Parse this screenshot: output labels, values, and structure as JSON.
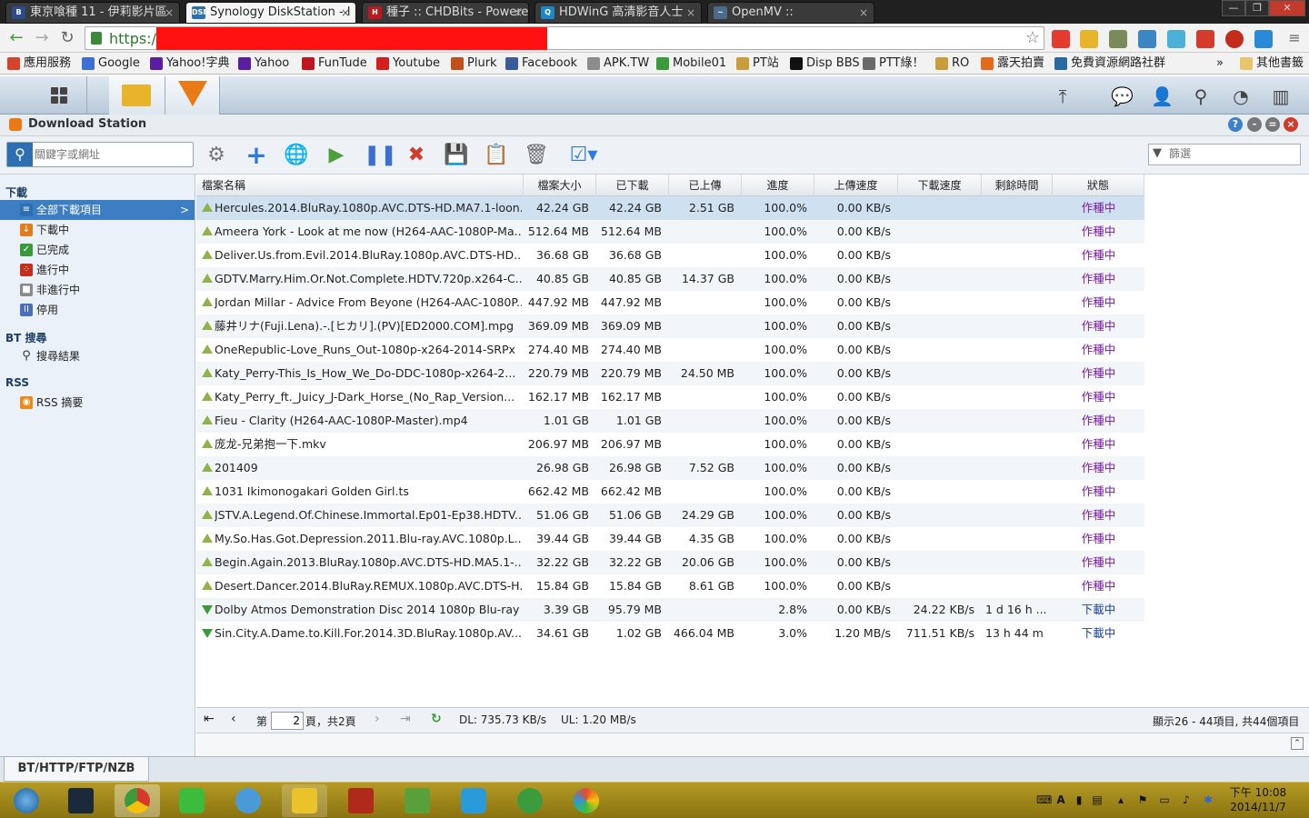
{
  "browser": {
    "tabs": [
      {
        "title": "東京喰種 11 - 伊莉影片區",
        "icon": "B",
        "color": "#2b4c8c"
      },
      {
        "title": "Synology DiskStation - l",
        "icon": "DSM",
        "color": "#2d6fb0"
      },
      {
        "title": "種子 :: CHDBits - Powere",
        "icon": "H",
        "color": "#c0161d"
      },
      {
        "title": "HDWinG 高清影音人士",
        "icon": "Q",
        "color": "#1a87c9"
      },
      {
        "title": "OpenMV ::",
        "icon": "~",
        "color": "#4a6b8a"
      }
    ],
    "close_glyph": "×",
    "url_scheme": "https://",
    "bookmarks": [
      {
        "label": "應用服務",
        "color": "#d4432b"
      },
      {
        "label": "Google",
        "color": "#3b6fd6"
      },
      {
        "label": "Yahoo!字典",
        "color": "#5a1fa0"
      },
      {
        "label": "Yahoo",
        "color": "#5a1fa0"
      },
      {
        "label": "FunTude",
        "color": "#c0161d"
      },
      {
        "label": "Youtube",
        "color": "#d4201c"
      },
      {
        "label": "Plurk",
        "color": "#c2501c"
      },
      {
        "label": "Facebook",
        "color": "#3a5a98"
      },
      {
        "label": "APK.TW",
        "color": "#8c8c8c"
      },
      {
        "label": "Mobile01",
        "color": "#3a9a3a"
      },
      {
        "label": "PT站",
        "color": "#c89d3b"
      },
      {
        "label": "Disp BBS",
        "color": "#111111"
      },
      {
        "label": "PTT綠！",
        "color": "#6a6a6a"
      },
      {
        "label": "RO",
        "color": "#c89d3b"
      },
      {
        "label": "露天拍賣",
        "color": "#e56b1a"
      },
      {
        "label": "免費資源網路社群",
        "color": "#2a6aa0"
      }
    ],
    "more": "»",
    "other_bookmarks": "其他書籤"
  },
  "app": {
    "title": "Download Station",
    "search_placeholder": "關鍵字或網址",
    "filter_placeholder": "篩選",
    "sidebar": {
      "download_group": "下載",
      "items": [
        {
          "label": "全部下載項目",
          "color": "#2d6fb0",
          "glyph": "≡"
        },
        {
          "label": "下載中",
          "color": "#e57b1a",
          "glyph": "↓"
        },
        {
          "label": "已完成",
          "color": "#3a9a3a",
          "glyph": "✓"
        },
        {
          "label": "進行中",
          "color": "#c0301c",
          "glyph": "⁘"
        },
        {
          "label": "非進行中",
          "color": "#8a8a8a",
          "glyph": "■"
        },
        {
          "label": "停用",
          "color": "#4a6fc0",
          "glyph": "II"
        }
      ],
      "bt_group": "BT 搜尋",
      "bt_item": "搜尋結果",
      "rss_group": "RSS",
      "rss_item": "RSS 摘要",
      "selected_arrow": ">"
    },
    "columns": [
      "檔案名稱",
      "檔案大小",
      "已下載",
      "已上傳",
      "進度",
      "上傳速度",
      "下載速度",
      "剩餘時間",
      "狀態"
    ],
    "rows": [
      {
        "name": "Hercules.2014.BluRay.1080p.AVC.DTS-HD.MA7.1-loon...",
        "size": "42.24 GB",
        "downloaded": "42.24 GB",
        "uploaded": "2.51 GB",
        "progress": "100.0%",
        "up_speed": "0.00 KB/s",
        "down_speed": "",
        "remaining": "",
        "status": "作種中",
        "kind": "seed"
      },
      {
        "name": "Ameera York - Look at me now (H264-AAC-1080P-Ma...",
        "size": "512.64 MB",
        "downloaded": "512.64 MB",
        "uploaded": "",
        "progress": "100.0%",
        "up_speed": "0.00 KB/s",
        "down_speed": "",
        "remaining": "",
        "status": "作種中",
        "kind": "seed"
      },
      {
        "name": "Deliver.Us.from.Evil.2014.BluRay.1080p.AVC.DTS-HD....",
        "size": "36.68 GB",
        "downloaded": "36.68 GB",
        "uploaded": "",
        "progress": "100.0%",
        "up_speed": "0.00 KB/s",
        "down_speed": "",
        "remaining": "",
        "status": "作種中",
        "kind": "seed"
      },
      {
        "name": "GDTV.Marry.Him.Or.Not.Complete.HDTV.720p.x264-C...",
        "size": "40.85 GB",
        "downloaded": "40.85 GB",
        "uploaded": "14.37 GB",
        "progress": "100.0%",
        "up_speed": "0.00 KB/s",
        "down_speed": "",
        "remaining": "",
        "status": "作種中",
        "kind": "seed"
      },
      {
        "name": "Jordan Millar - Advice From Beyone (H264-AAC-1080P...",
        "size": "447.92 MB",
        "downloaded": "447.92 MB",
        "uploaded": "",
        "progress": "100.0%",
        "up_speed": "0.00 KB/s",
        "down_speed": "",
        "remaining": "",
        "status": "作種中",
        "kind": "seed"
      },
      {
        "name": "藤井リナ(Fuji.Lena).-.[ヒカリ].(PV)[ED2000.COM].mpg",
        "size": "369.09 MB",
        "downloaded": "369.09 MB",
        "uploaded": "",
        "progress": "100.0%",
        "up_speed": "0.00 KB/s",
        "down_speed": "",
        "remaining": "",
        "status": "作種中",
        "kind": "seed"
      },
      {
        "name": "OneRepublic-Love_Runs_Out-1080p-x264-2014-SRPx",
        "size": "274.40 MB",
        "downloaded": "274.40 MB",
        "uploaded": "",
        "progress": "100.0%",
        "up_speed": "0.00 KB/s",
        "down_speed": "",
        "remaining": "",
        "status": "作種中",
        "kind": "seed"
      },
      {
        "name": "Katy_Perry-This_Is_How_We_Do-DDC-1080p-x264-2...",
        "size": "220.79 MB",
        "downloaded": "220.79 MB",
        "uploaded": "24.50 MB",
        "progress": "100.0%",
        "up_speed": "0.00 KB/s",
        "down_speed": "",
        "remaining": "",
        "status": "作種中",
        "kind": "seed"
      },
      {
        "name": "Katy_Perry_ft._Juicy_J-Dark_Horse_(No_Rap_Version...",
        "size": "162.17 MB",
        "downloaded": "162.17 MB",
        "uploaded": "",
        "progress": "100.0%",
        "up_speed": "0.00 KB/s",
        "down_speed": "",
        "remaining": "",
        "status": "作種中",
        "kind": "seed"
      },
      {
        "name": "Fieu - Clarity (H264-AAC-1080P-Master).mp4",
        "size": "1.01 GB",
        "downloaded": "1.01 GB",
        "uploaded": "",
        "progress": "100.0%",
        "up_speed": "0.00 KB/s",
        "down_speed": "",
        "remaining": "",
        "status": "作種中",
        "kind": "seed"
      },
      {
        "name": "庞龙-兄弟抱一下.mkv",
        "size": "206.97 MB",
        "downloaded": "206.97 MB",
        "uploaded": "",
        "progress": "100.0%",
        "up_speed": "0.00 KB/s",
        "down_speed": "",
        "remaining": "",
        "status": "作種中",
        "kind": "seed"
      },
      {
        "name": "201409",
        "size": "26.98 GB",
        "downloaded": "26.98 GB",
        "uploaded": "7.52 GB",
        "progress": "100.0%",
        "up_speed": "0.00 KB/s",
        "down_speed": "",
        "remaining": "",
        "status": "作種中",
        "kind": "seed"
      },
      {
        "name": "1031 Ikimonogakari Golden Girl.ts",
        "size": "662.42 MB",
        "downloaded": "662.42 MB",
        "uploaded": "",
        "progress": "100.0%",
        "up_speed": "0.00 KB/s",
        "down_speed": "",
        "remaining": "",
        "status": "作種中",
        "kind": "seed"
      },
      {
        "name": "JSTV.A.Legend.Of.Chinese.Immortal.Ep01-Ep38.HDTV...",
        "size": "51.06 GB",
        "downloaded": "51.06 GB",
        "uploaded": "24.29 GB",
        "progress": "100.0%",
        "up_speed": "0.00 KB/s",
        "down_speed": "",
        "remaining": "",
        "status": "作種中",
        "kind": "seed"
      },
      {
        "name": "My.So.Has.Got.Depression.2011.Blu-ray.AVC.1080p.L...",
        "size": "39.44 GB",
        "downloaded": "39.44 GB",
        "uploaded": "4.35 GB",
        "progress": "100.0%",
        "up_speed": "0.00 KB/s",
        "down_speed": "",
        "remaining": "",
        "status": "作種中",
        "kind": "seed"
      },
      {
        "name": "Begin.Again.2013.BluRay.1080p.AVC.DTS-HD.MA5.1-...",
        "size": "32.22 GB",
        "downloaded": "32.22 GB",
        "uploaded": "20.06 GB",
        "progress": "100.0%",
        "up_speed": "0.00 KB/s",
        "down_speed": "",
        "remaining": "",
        "status": "作種中",
        "kind": "seed"
      },
      {
        "name": "Desert.Dancer.2014.BluRay.REMUX.1080p.AVC.DTS-H...",
        "size": "15.84 GB",
        "downloaded": "15.84 GB",
        "uploaded": "8.61 GB",
        "progress": "100.0%",
        "up_speed": "0.00 KB/s",
        "down_speed": "",
        "remaining": "",
        "status": "作種中",
        "kind": "seed"
      },
      {
        "name": "Dolby Atmos Demonstration Disc 2014 1080p Blu-ray ...",
        "size": "3.39 GB",
        "downloaded": "95.79 MB",
        "uploaded": "",
        "progress": "2.8%",
        "up_speed": "0.00 KB/s",
        "down_speed": "24.22 KB/s",
        "remaining": "1 d 16 h ...",
        "status": "下載中",
        "kind": "dl"
      },
      {
        "name": "Sin.City.A.Dame.to.Kill.For.2014.3D.BluRay.1080p.AV...",
        "size": "34.61 GB",
        "downloaded": "1.02 GB",
        "uploaded": "466.04 MB",
        "progress": "3.0%",
        "up_speed": "1.20 MB/s",
        "down_speed": "711.51 KB/s",
        "remaining": "13 h 44 m",
        "status": "下載中",
        "kind": "dl"
      }
    ],
    "pager": {
      "page_prefix": "第",
      "page_value": "2",
      "page_suffix": "頁，共2頁",
      "dl": "DL: 735.73 KB/s",
      "ul": "UL: 1.20 MB/s",
      "summary": "顯示26 - 44項目, 共44個項目"
    },
    "bottom_tab": "BT/HTTP/FTP/NZB"
  },
  "taskbar": {
    "time": "下午 10:08",
    "date": "2014/11/7"
  }
}
